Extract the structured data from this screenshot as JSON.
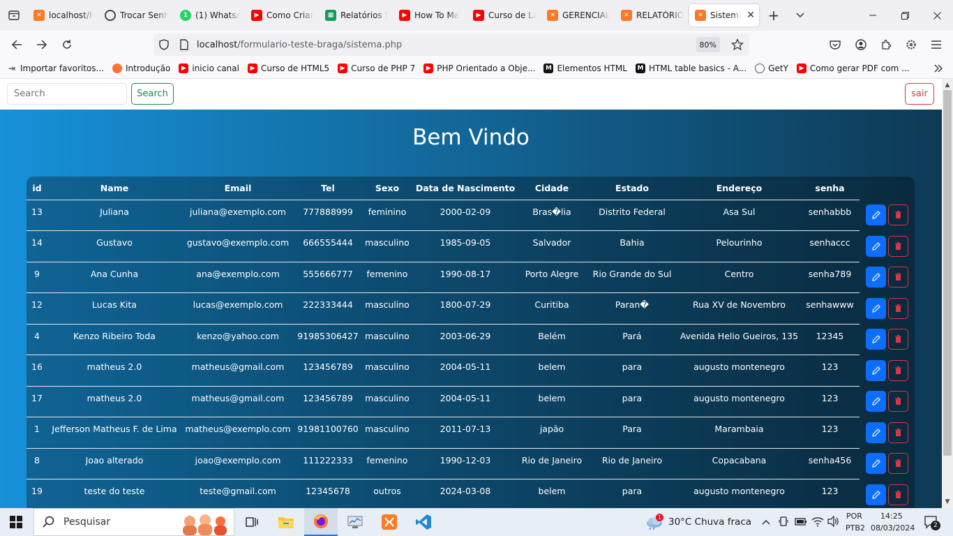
{
  "browser": {
    "tabs": [
      {
        "label": "localhost/H",
        "icon": "xampp-icon",
        "color": "#fb7a24"
      },
      {
        "label": "Trocar Senh",
        "icon": "chatgpt-icon",
        "color": "#444444"
      },
      {
        "label": "(1) WhatsAp",
        "icon": "whatsapp-icon",
        "color": "#25d366"
      },
      {
        "label": "Como Criar",
        "icon": "youtube-icon",
        "color": "#ff0000"
      },
      {
        "label": "Relatórios S",
        "icon": "sheets-icon",
        "color": "#0f9d58"
      },
      {
        "label": "How To Ma",
        "icon": "youtube-icon",
        "color": "#ff0000"
      },
      {
        "label": "Curso de La",
        "icon": "youtube-icon",
        "color": "#ff0000"
      },
      {
        "label": "GERENCIAL",
        "icon": "xampp-icon",
        "color": "#fb7a24"
      },
      {
        "label": "RELATÓRIOS",
        "icon": "xampp-icon",
        "color": "#fb7a24"
      },
      {
        "label": "Sistema",
        "icon": "xampp-icon",
        "color": "#fb7a24"
      }
    ],
    "new_tab": "+",
    "url_host": "localhost",
    "url_path": "/formulario-teste-braga/sistema.php",
    "zoom": "80%",
    "bookmarks": [
      {
        "label": "Importar favoritos...",
        "icon": "import-icon",
        "color": "#555555"
      },
      {
        "label": "Introdução",
        "icon": "firefox-icon",
        "color": "#ff7139"
      },
      {
        "label": "inicio canal",
        "icon": "youtube-icon",
        "color": "#ff0000"
      },
      {
        "label": "Curso de HTML5",
        "icon": "youtube-icon",
        "color": "#ff0000"
      },
      {
        "label": "Curso de PHP 7",
        "icon": "youtube-icon",
        "color": "#ff0000"
      },
      {
        "label": "PHP Orientado a Obje...",
        "icon": "youtube-icon",
        "color": "#ff0000"
      },
      {
        "label": "Elementos HTML",
        "icon": "mdn-icon",
        "color": "#111111"
      },
      {
        "label": "HTML table basics - A...",
        "icon": "mdn-icon",
        "color": "#111111"
      },
      {
        "label": "GetY",
        "icon": "globe-icon",
        "color": "#555555"
      },
      {
        "label": "Como gerar PDF com ...",
        "icon": "youtube-icon",
        "color": "#ff0000"
      }
    ]
  },
  "page": {
    "search_placeholder": "Search",
    "search_button": "Search",
    "logout_button": "sair",
    "title": "Bem Vindo",
    "columns": [
      "id",
      "Name",
      "Email",
      "Tel",
      "Sexo",
      "Data de Nascimento",
      "Cidade",
      "Estado",
      "Endereço",
      "senha"
    ],
    "rows": [
      [
        "13",
        "Juliana",
        "juliana@exemplo.com",
        "777888999",
        "feminino",
        "2000-02-09",
        "Bras�lia",
        "Distrito Federal",
        "Asa Sul",
        "senhabbb"
      ],
      [
        "14",
        "Gustavo",
        "gustavo@exemplo.com",
        "666555444",
        "masculino",
        "1985-09-05",
        "Salvador",
        "Bahia",
        "Pelourinho",
        "senhaccc"
      ],
      [
        "9",
        "Ana Cunha",
        "ana@exemplo.com",
        "555666777",
        "femenino",
        "1990-08-17",
        "Porto Alegre",
        "Rio Grande do Sul",
        "Centro",
        "senha789"
      ],
      [
        "12",
        "Lucas Kita",
        "lucas@exemplo.com",
        "222333444",
        "masculino",
        "1800-07-29",
        "Curitiba",
        "Paran�",
        "Rua XV de Novembro",
        "senhawww"
      ],
      [
        "4",
        "Kenzo Ribeiro Toda",
        "kenzo@yahoo.com",
        "91985306427",
        "masculino",
        "2003-06-29",
        "Belém",
        "Pará",
        "Avenida Helio Gueiros, 135",
        "12345"
      ],
      [
        "16",
        "matheus 2.0",
        "matheus@gmail.com",
        "123456789",
        "masculino",
        "2004-05-11",
        "belem",
        "para",
        "augusto montenegro",
        "123"
      ],
      [
        "17",
        "matheus 2.0",
        "matheus@gmail.com",
        "123456789",
        "masculino",
        "2004-05-11",
        "belem",
        "para",
        "augusto montenegro",
        "123"
      ],
      [
        "1",
        "Jefferson Matheus F. de Lima",
        "matheus@exemplo.com",
        "91981100760",
        "masculino",
        "2011-07-13",
        "japão",
        "Para",
        "Marambaia",
        "123"
      ],
      [
        "8",
        "Joao alterado",
        "joao@exemplo.com",
        "111222333",
        "femenino",
        "1990-12-03",
        "Rio de Janeiro",
        "Rio de Janeiro",
        "Copacabana",
        "senha456"
      ],
      [
        "19",
        "teste do teste",
        "teste@gmail.com",
        "12345678",
        "outros",
        "2024-03-08",
        "belem",
        "para",
        "augusto montenegro",
        "123"
      ]
    ]
  },
  "taskbar": {
    "search_placeholder": "Pesquisar",
    "weather": "30°C  Chuva fraca",
    "weather_badge": "1",
    "lang_line1": "POR",
    "lang_line2": "PTB2",
    "time": "14:25",
    "date": "08/03/2024",
    "notifications": "2"
  },
  "colors": {
    "gradient_start": "#1791d9",
    "gradient_end": "#0e3a55",
    "edit_button": "#0d6efd",
    "delete_border": "#dc3545",
    "search_button": "#198754"
  }
}
